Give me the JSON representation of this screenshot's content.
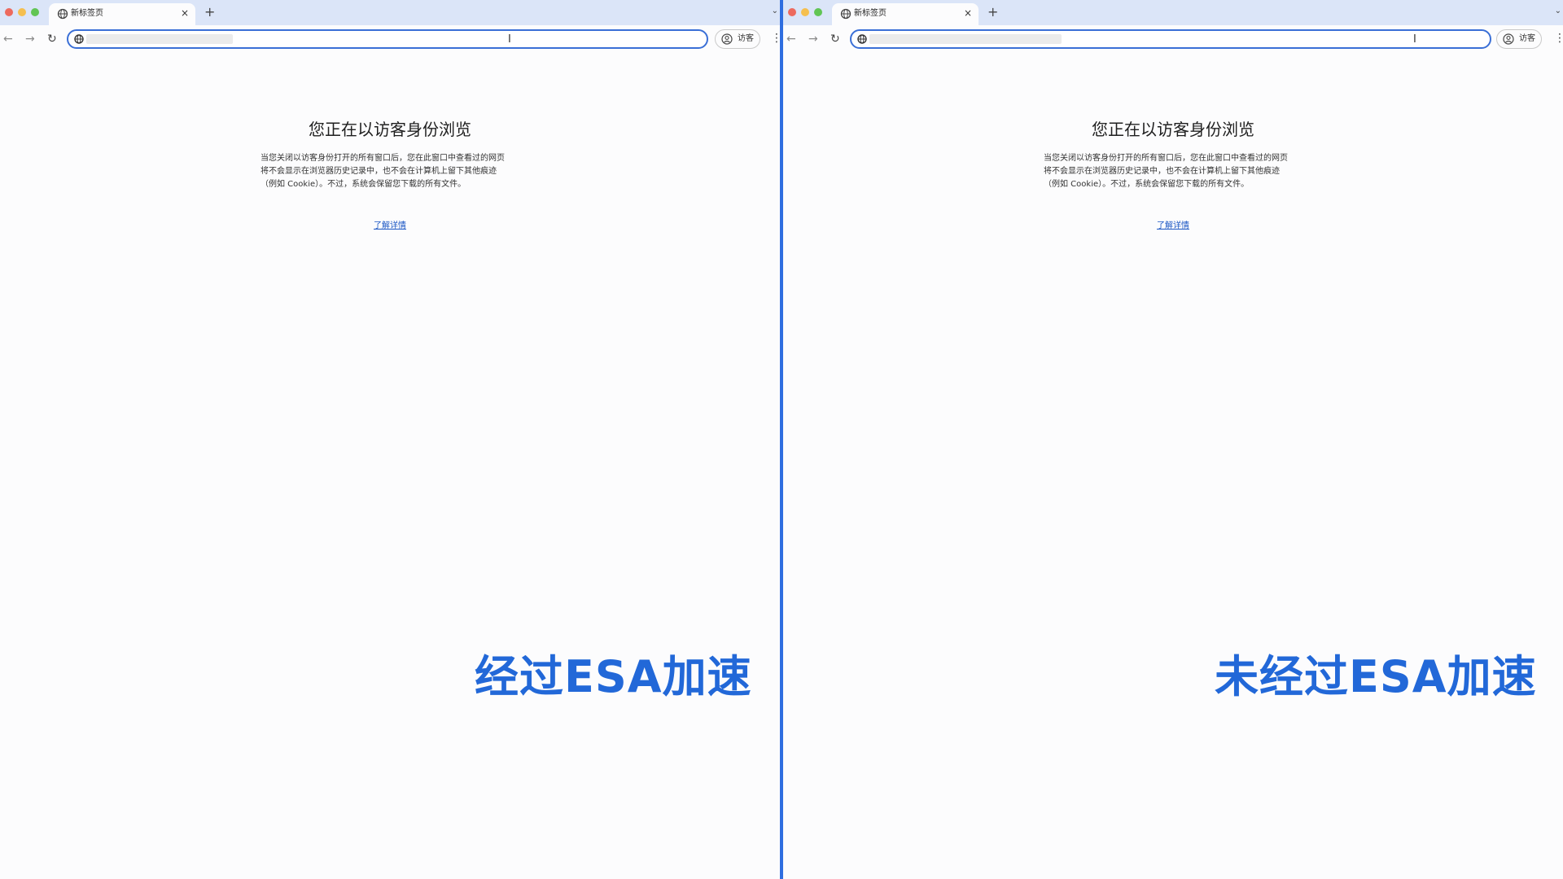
{
  "panes": [
    {
      "tab_title": "新标签页",
      "tab_close": "×",
      "new_tab": "+",
      "tab_menu": "⌄",
      "nav_back": "←",
      "nav_forward": "→",
      "nav_reload": "↻",
      "profile_label": "访客",
      "menu": "⋮",
      "heading": "您正在以访客身份浏览",
      "para_lines": [
        "当您关闭以访客身份打开的所有窗口后，您在此窗口中查看过的网页",
        "将不会显示在浏览器历史记录中，也不会在计算机上留下其他痕迹",
        "（例如 Cookie）。不过，系统会保留您下载的所有文件。"
      ],
      "learn_more": "了解详情",
      "overlay": "经过ESA加速"
    },
    {
      "tab_title": "新标签页",
      "tab_close": "×",
      "new_tab": "+",
      "tab_menu": "⌄",
      "nav_back": "←",
      "nav_forward": "→",
      "nav_reload": "↻",
      "profile_label": "访客",
      "menu": "⋮",
      "heading": "您正在以访客身份浏览",
      "para_lines": [
        "当您关闭以访客身份打开的所有窗口后，您在此窗口中查看过的网页",
        "将不会显示在浏览器历史记录中，也不会在计算机上留下其他痕迹",
        "（例如 Cookie）。不过，系统会保留您下载的所有文件。"
      ],
      "learn_more": "了解详情",
      "overlay": "未经过ESA加速"
    }
  ],
  "icons": {
    "tab_favicon": "globe-icon",
    "omnibox_icon": "globe-icon",
    "profile_icon": "guest-avatar-icon"
  },
  "colors": {
    "accent": "#2f6ee0",
    "overlay_text": "#2268d8",
    "tabstrip": "#dbe5f8"
  }
}
